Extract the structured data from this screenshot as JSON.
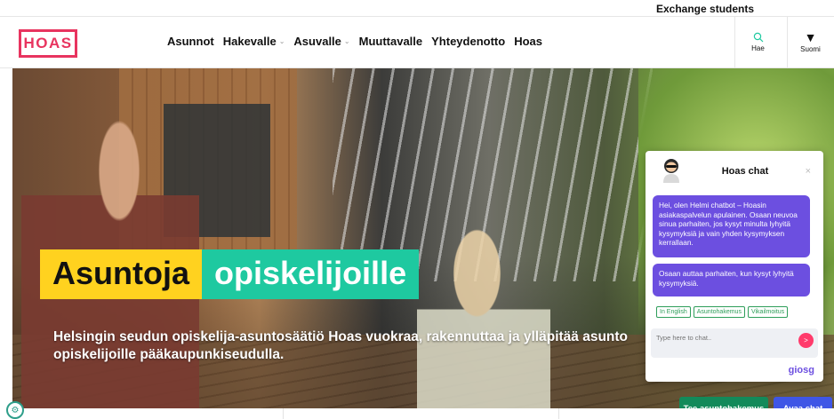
{
  "topbar": {
    "exchange_link": "Exchange students"
  },
  "header": {
    "logo_text": "HOAS",
    "nav": [
      {
        "label": "Asunnot",
        "dropdown": false
      },
      {
        "label": "Hakevalle",
        "dropdown": true
      },
      {
        "label": "Asuvalle",
        "dropdown": true
      },
      {
        "label": "Muuttavalle",
        "dropdown": false
      },
      {
        "label": "Yhteydenotto",
        "dropdown": false
      },
      {
        "label": "Hoas",
        "dropdown": false
      }
    ],
    "search_label": "Hae",
    "search_icon": "search-icon",
    "language_label": "Suomi",
    "language_icon": "triangle-down-icon"
  },
  "hero": {
    "headline_part1": "Asuntoja",
    "headline_part2": "opiskelijoille",
    "subtext_line1": "Helsingin seudun opiskelija-asuntosäätiö Hoas vuokraa, rakennuttaa ja ylläpitää asunto",
    "subtext_line2": "opiskelijoille pääkaupunkiseudulla."
  },
  "chat": {
    "title": "Hoas chat",
    "close_symbol": "×",
    "message1": "Hei, olen Helmi chatbot – Hoasin asiakaspalvelun apulainen. Osaan neuvoa sinua parhaiten, jos kysyt minulta lyhyitä kysymyksiä ja vain yhden kysymyksen kerrallaan.",
    "message2": "Osaan auttaa parhaiten, kun kysyt lyhyitä kysymyksiä.",
    "quick_replies": [
      "In English",
      "Asuntohakemus",
      "Vikailmoitus"
    ],
    "input_placeholder": "Type here to chat..",
    "send_symbol": ">",
    "brand": "giosg"
  },
  "cta": {
    "apply_label": "Tee asuntohakemus",
    "open_chat_label": "Avaa chat"
  },
  "colors": {
    "brand_pink": "#e8345f",
    "yellow": "#ffd21f",
    "teal": "#1ec9a0",
    "chat_purple": "#6c4fe0",
    "cta_green": "#138a5a",
    "cta_blue": "#3f56e6"
  }
}
